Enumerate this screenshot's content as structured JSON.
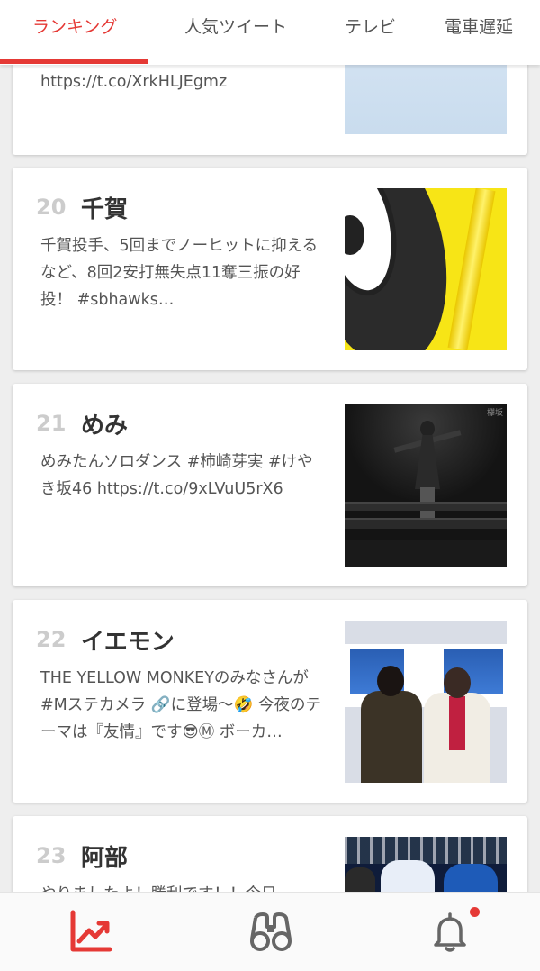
{
  "tabs": [
    {
      "label": "ランキング",
      "active": true
    },
    {
      "label": "人気ツイート",
      "active": false
    },
    {
      "label": "テレビ",
      "active": false
    },
    {
      "label": "電車遅延",
      "active": false
    }
  ],
  "accent_color": "#e53935",
  "cards": [
    {
      "rank": "",
      "keyword": "",
      "snippet": "https://t.co/XrkHLJEgmz",
      "thumb_icon": "portrait-photo"
    },
    {
      "rank": "20",
      "keyword": "千賀",
      "snippet": "千賀投手、5回までノーヒットに抑えるなど、8回2安打無失点11奪三振の好投！ #sbhawks…",
      "thumb_icon": "cartoon-photo"
    },
    {
      "rank": "21",
      "keyword": "めみ",
      "snippet": "めみたんソロダンス #柿崎芽実 #けやき坂46 https://t.co/9xLVuU5rX6",
      "thumb_icon": "stage-dance-photo"
    },
    {
      "rank": "22",
      "keyword": "イエモン",
      "snippet": "THE YELLOW MONKEYのみなさんが #Mステカメラ 🔗に登場〜🤣 今夜のテーマは『友情』です😎Ⓜ ボーカ…",
      "thumb_icon": "band-photo"
    },
    {
      "rank": "23",
      "keyword": "阿部",
      "snippet": "やりましたよ！勝利です！！今日",
      "thumb_icon": "baseball-photo"
    }
  ],
  "thumb_watermark": "欅坂",
  "bottom_nav": [
    {
      "icon": "trending-chart-icon",
      "active": true
    },
    {
      "icon": "binoculars-icon",
      "active": false
    },
    {
      "icon": "bell-icon",
      "active": false,
      "badge": true
    }
  ]
}
